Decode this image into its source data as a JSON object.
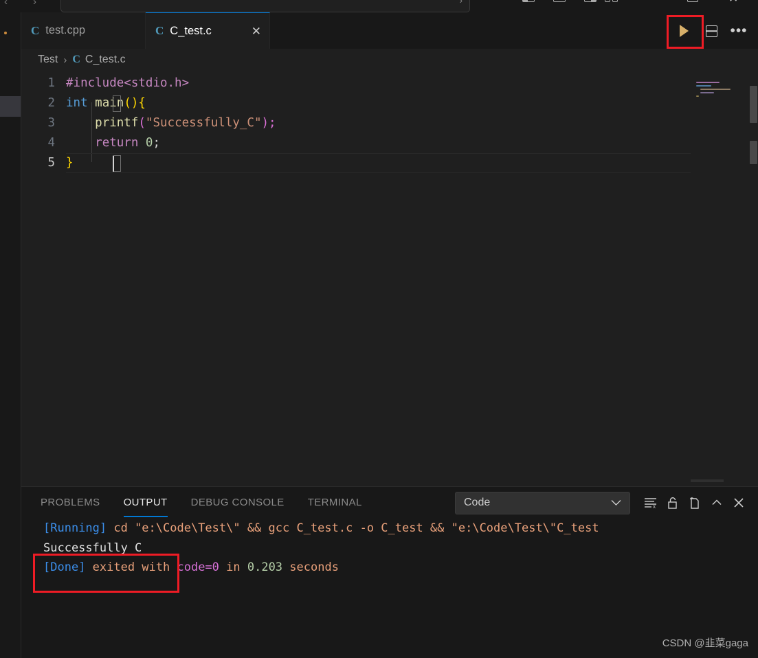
{
  "titlebar": {
    "back_icon": "chevron-left-icon",
    "forward_icon": "chevron-right-icon",
    "search_placeholder": "",
    "search_value": "",
    "close_label": "✕"
  },
  "tabs": [
    {
      "label": "test.cpp",
      "icon": "cpp-file-icon",
      "icon_glyph": "C",
      "active": false
    },
    {
      "label": "C_test.c",
      "icon": "c-file-icon",
      "icon_glyph": "C",
      "active": true,
      "close_label": "✕"
    }
  ],
  "editor_actions": {
    "run_label": "run-code-button",
    "split_label": "split-editor-button",
    "more_label": "•••"
  },
  "breadcrumb": {
    "folder": "Test",
    "separator": "›",
    "file_icon_glyph": "C",
    "file": "C_test.c"
  },
  "code": {
    "lines": [
      {
        "num": "1",
        "tokens": [
          {
            "t": "#include",
            "c": "t-pre"
          },
          {
            "t": "<stdio.h>",
            "c": "t-pre"
          }
        ]
      },
      {
        "num": "2",
        "tokens": [
          {
            "t": "int",
            "c": "t-key"
          },
          {
            "t": " ",
            "c": "t-plain"
          },
          {
            "t": "main",
            "c": "t-fn"
          },
          {
            "t": "(",
            "c": "t-p1"
          },
          {
            "t": ")",
            "c": "t-p1"
          },
          {
            "t": "{",
            "c": "t-p1"
          }
        ]
      },
      {
        "num": "3",
        "tokens": [
          {
            "t": "    ",
            "c": "t-plain"
          },
          {
            "t": "printf",
            "c": "t-fn"
          },
          {
            "t": "(",
            "c": "t-p2"
          },
          {
            "t": "\"Successfully_C\"",
            "c": "t-str"
          },
          {
            "t": ")",
            "c": "t-p2"
          },
          {
            "t": ";",
            "c": "t-p2"
          }
        ]
      },
      {
        "num": "4",
        "tokens": [
          {
            "t": "    ",
            "c": "t-plain"
          },
          {
            "t": "return",
            "c": "t-ctrl"
          },
          {
            "t": " ",
            "c": "t-plain"
          },
          {
            "t": "0",
            "c": "t-num"
          },
          {
            "t": ";",
            "c": "t-punc"
          }
        ]
      },
      {
        "num": "5",
        "tokens": [
          {
            "t": "}",
            "c": "t-p1"
          }
        ]
      }
    ],
    "full_text": "#include<stdio.h>\nint main(){\n    printf(\"Successfully_C\");\n    return 0;\n}"
  },
  "panel": {
    "tabs": [
      {
        "label": "PROBLEMS",
        "active": false
      },
      {
        "label": "OUTPUT",
        "active": true
      },
      {
        "label": "DEBUG CONSOLE",
        "active": false
      },
      {
        "label": "TERMINAL",
        "active": false
      }
    ],
    "channel_selected": "Code",
    "channel_chevron": "⌄",
    "actions": [
      {
        "name": "clear-output-icon"
      },
      {
        "name": "lock-scroll-icon"
      },
      {
        "name": "open-in-editor-icon"
      },
      {
        "name": "collapse-panel-icon",
        "glyph": "⌃"
      },
      {
        "name": "close-panel-icon",
        "glyph": "✕"
      }
    ],
    "output_lines": [
      {
        "segments": [
          {
            "t": "[Running]",
            "c": "o-blue"
          },
          {
            "t": " cd ",
            "c": "o-or"
          },
          {
            "t": "\"e:\\Code\\Test\\\" && gcc C_test.c -o C_test && \"e:\\Code\\Test\\\"C_test",
            "c": "o-or"
          }
        ]
      },
      {
        "segments": [
          {
            "t": "Successfully_C",
            "c": "o-white"
          }
        ]
      },
      {
        "segments": [
          {
            "t": "[Done]",
            "c": "o-blue"
          },
          {
            "t": " exited with ",
            "c": "o-or"
          },
          {
            "t": "code=0",
            "c": "o-mag"
          },
          {
            "t": " in ",
            "c": "o-or"
          },
          {
            "t": "0.203",
            "c": "o-green"
          },
          {
            "t": " seconds",
            "c": "o-or"
          }
        ]
      }
    ]
  },
  "watermark": "CSDN @韭菜gaga",
  "colors": {
    "accent": "#0078d4",
    "highlight_box": "#ee1c25",
    "editor_bg": "#1f1f1f",
    "panel_bg": "#181818"
  }
}
